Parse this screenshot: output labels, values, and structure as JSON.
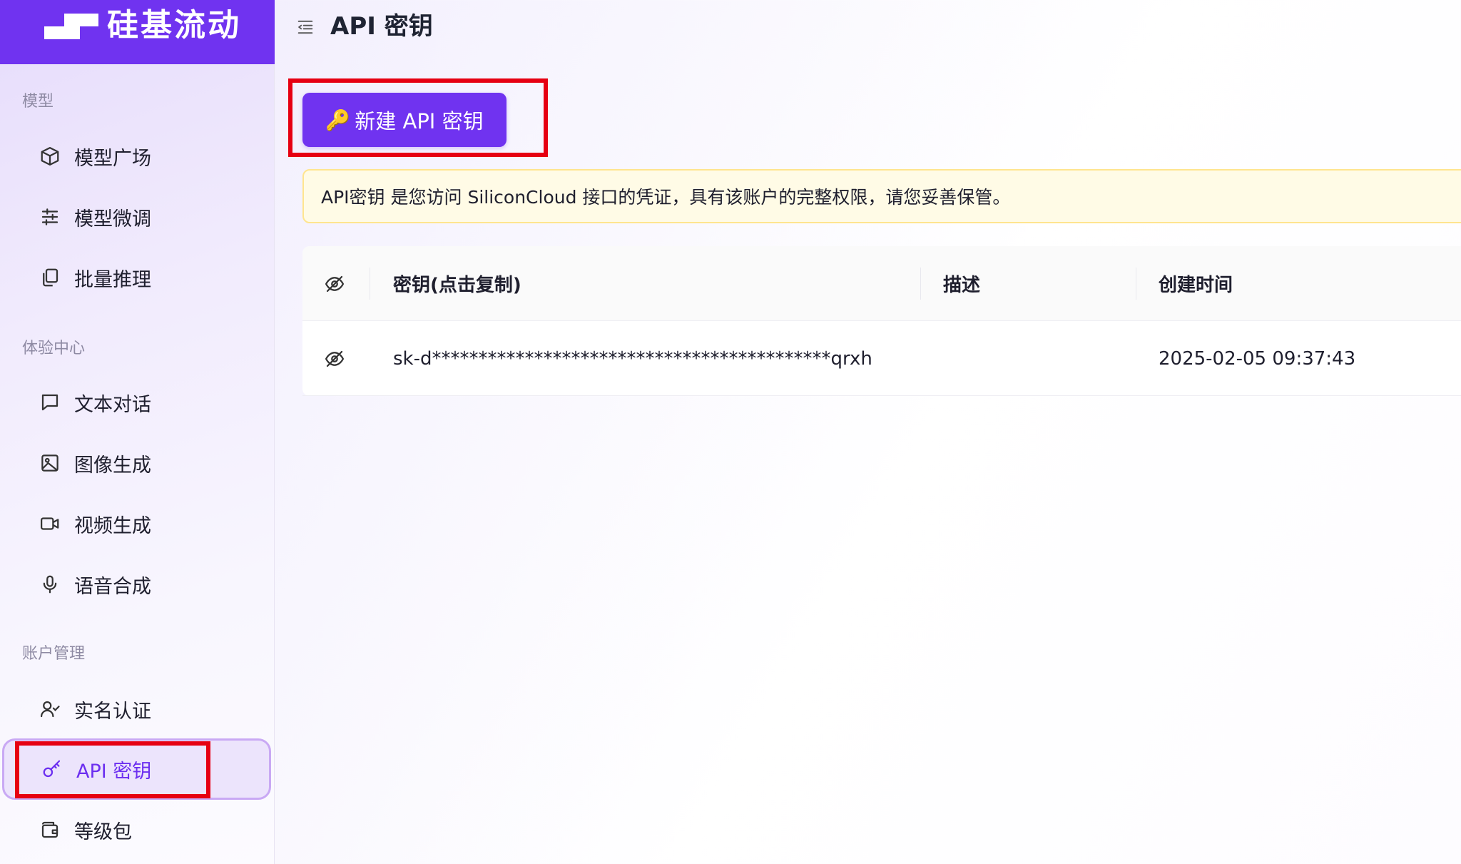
{
  "brand": {
    "name": "硅基流动"
  },
  "sidebar": {
    "sections": [
      {
        "label": "模型",
        "items": [
          {
            "label": "模型广场",
            "icon": "cube-icon"
          },
          {
            "label": "模型微调",
            "icon": "sliders-icon"
          },
          {
            "label": "批量推理",
            "icon": "copy-icon"
          }
        ]
      },
      {
        "label": "体验中心",
        "items": [
          {
            "label": "文本对话",
            "icon": "chat-icon"
          },
          {
            "label": "图像生成",
            "icon": "image-icon"
          },
          {
            "label": "视频生成",
            "icon": "video-icon"
          },
          {
            "label": "语音合成",
            "icon": "microphone-icon"
          }
        ]
      },
      {
        "label": "账户管理",
        "items": [
          {
            "label": "实名认证",
            "icon": "user-check-icon"
          },
          {
            "label": "API 密钥",
            "icon": "key-icon",
            "active": true
          },
          {
            "label": "等级包",
            "icon": "wallet-icon"
          }
        ]
      }
    ]
  },
  "header": {
    "title": "API 密钥"
  },
  "create_button": {
    "label": "新建 API 密钥",
    "icon": "🔑"
  },
  "notice": {
    "text": "API密钥 是您访问 SiliconCloud 接口的凭证，具有该账户的完整权限，请您妥善保管。"
  },
  "table": {
    "columns": [
      "密钥(点击复制)",
      "描述",
      "创建时间"
    ],
    "rows": [
      {
        "key": "sk-d*******************************************qrxh",
        "description": "",
        "created": "2025-02-05 09:37:43"
      }
    ]
  },
  "colors": {
    "accent": "#7033f0",
    "highlight_box": "#e60012",
    "notice_bg": "#fffbe6",
    "notice_border": "#ffe58f"
  }
}
